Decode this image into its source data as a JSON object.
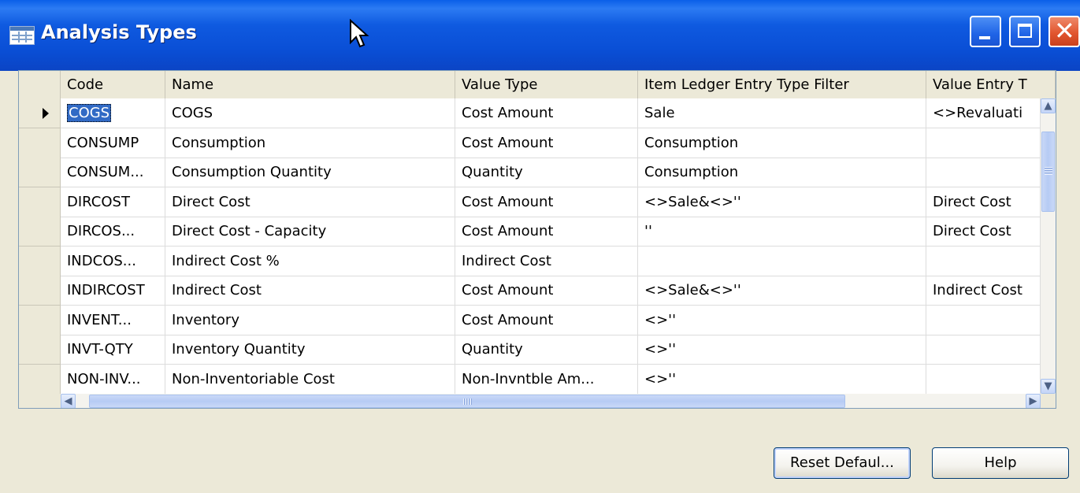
{
  "window": {
    "title": "Analysis Types"
  },
  "grid": {
    "columns": [
      "Code",
      "Name",
      "Value Type",
      "Item Ledger Entry Type Filter",
      "Value Entry T"
    ],
    "rows": [
      [
        "COGS",
        "COGS",
        "Cost Amount",
        "Sale",
        "<>Revaluati"
      ],
      [
        "CONSUMP",
        "Consumption",
        "Cost Amount",
        "Consumption",
        ""
      ],
      [
        "CONSUM...",
        "Consumption Quantity",
        "Quantity",
        "Consumption",
        ""
      ],
      [
        "DIRCOST",
        "Direct Cost",
        "Cost Amount",
        "<>Sale&<>''",
        "Direct Cost"
      ],
      [
        "DIRCOS...",
        "Direct Cost - Capacity",
        "Cost Amount",
        "''",
        "Direct Cost"
      ],
      [
        "INDCOS...",
        "Indirect Cost %",
        "Indirect Cost",
        "",
        ""
      ],
      [
        "INDIRCOST",
        "Indirect Cost",
        "Cost Amount",
        "<>Sale&<>''",
        "Indirect Cost"
      ],
      [
        "INVENT...",
        "Inventory",
        "Cost Amount",
        "<>''",
        ""
      ],
      [
        "INVT-QTY",
        "Inventory Quantity",
        "Quantity",
        "<>''",
        ""
      ],
      [
        "NON-INV...",
        "Non-Inventoriable Cost",
        "Non-Invntble Am...",
        "<>''",
        ""
      ]
    ],
    "selected_row": 0
  },
  "buttons": {
    "reset": "Reset Defaul...",
    "help": "Help"
  },
  "icons": {
    "window": "table-icon",
    "minimize": "minimize-icon",
    "maximize": "maximize-icon",
    "close": "close-icon"
  },
  "colors": {
    "titlebar": "#0a4fd6",
    "selection": "#316ac5",
    "close_button": "#e2562f",
    "face": "#ece9d8"
  }
}
